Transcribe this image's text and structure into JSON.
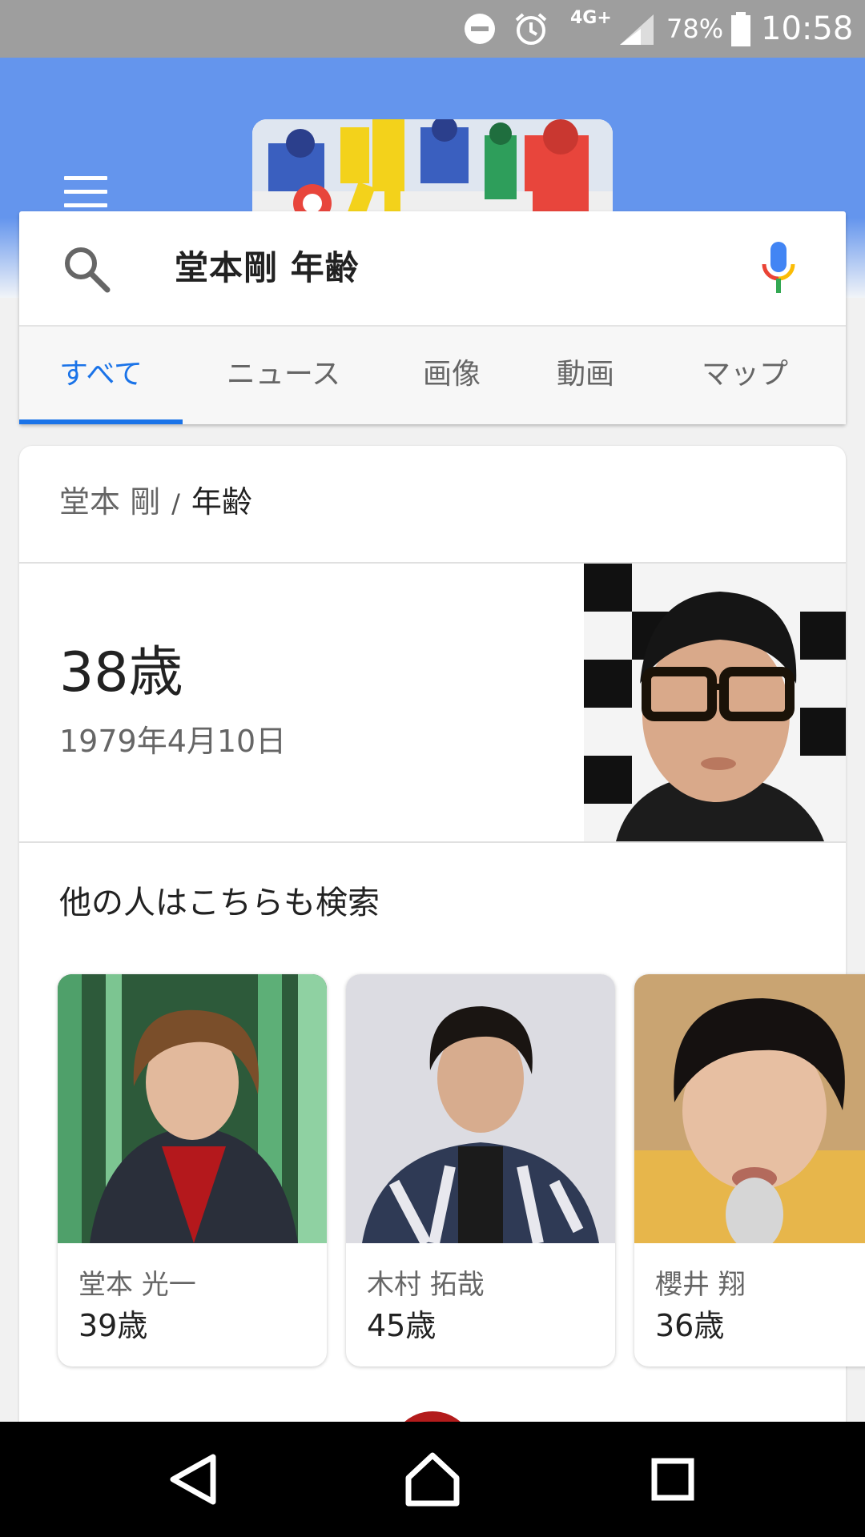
{
  "status_bar": {
    "network": "4G+",
    "battery": "78%",
    "time": "10:58",
    "icons": [
      "do-not-disturb-icon",
      "alarm-icon",
      "signal-icon",
      "battery-icon"
    ]
  },
  "header": {
    "menu_icon": "hamburger-menu-icon",
    "doodle_icon": "winter-sports-doodle"
  },
  "search": {
    "query": "堂本剛 年齢",
    "search_icon": "search-icon",
    "mic_icon": "microphone-icon"
  },
  "tabs": [
    {
      "label": "すべて",
      "active": true
    },
    {
      "label": "ニュース",
      "active": false
    },
    {
      "label": "画像",
      "active": false
    },
    {
      "label": "動画",
      "active": false
    },
    {
      "label": "マップ",
      "active": false
    }
  ],
  "result": {
    "breadcrumb": {
      "entity": "堂本 剛",
      "separator": "/",
      "attribute": "年齢"
    },
    "age": "38歳",
    "date_of_birth": "1979年4月10日",
    "also_search_title": "他の人はこちらも検索",
    "related_people": [
      {
        "name": "堂本 光一",
        "age": "39歳"
      },
      {
        "name": "木村 拓哉",
        "age": "45歳"
      },
      {
        "name": "櫻井 翔",
        "age": "36歳"
      }
    ]
  },
  "nav_bar": {
    "back_icon": "back-triangle-icon",
    "home_icon": "home-icon",
    "recents_icon": "recents-square-icon"
  },
  "colors": {
    "header_blue": "#6495ed",
    "accent_blue": "#1a73e8",
    "status_bar": "#9e9e9e"
  }
}
